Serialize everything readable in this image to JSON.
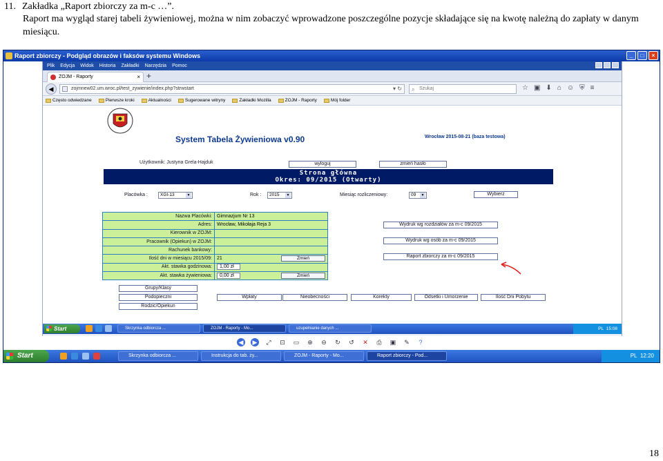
{
  "doc": {
    "number": "11.",
    "heading": "Zakładka „Raport zbiorczy za m-c …”.",
    "paragraph": "Raport ma wygląd starej tabeli żywieniowej, można w nim zobaczyć wprowadzone poszczególne pozycje składające się na kwotę należną do zapłaty w danym miesiącu.",
    "page_number": "18"
  },
  "outer_window": {
    "title": "Raport zbiorczy - Podgląd obrazów i faksów systemu Windows"
  },
  "browser": {
    "menu": [
      "Plik",
      "Edycja",
      "Widok",
      "Historia",
      "Zakładki",
      "Narzędzia",
      "Pomoc"
    ],
    "tab_title": "ZOJM - Raporty",
    "new_tab": "+",
    "url": "zojmnew02.um.wroc.pl/test_zywienie/index.php?strwstart",
    "search_placeholder": "Szukaj",
    "bookmarks": [
      "Często odwiedzane",
      "Pierwsze kroki",
      "Aktualności",
      "Sugerowane witryny",
      "Zakładki Mozilla",
      "ZOJM - Raporty",
      "Mój folder"
    ]
  },
  "app": {
    "title": "System Tabela Żywieniowa v0.90",
    "date_info": "Wrocław 2015-08-21 (baza testowa)",
    "user_label": "Użytkownik: Justyna Grela-Hajduk",
    "logout_button": "wyloguj",
    "change_password_button": "zmień hasło",
    "banner_line1": "Strona główna",
    "banner_line2": "Okres: 09/2015 (Otwarty)",
    "placowka_label": "Placówka :",
    "placowka_value": "XGI-13",
    "rok_label": "Rok :",
    "rok_value": "2015",
    "miesiac_label": "Miesiąc rozliczeniowy:",
    "miesiac_value": "09",
    "wybierz_button": "Wybierz",
    "info": {
      "nazwa_label": "Nazwa Placówki:",
      "nazwa_value": "Gimnazjum Nr 13",
      "adres_label": "Adres:",
      "adres_value": "Wrocław, Mikołaja Reja 3",
      "kierownik_label": "Kierownik w ZOJM:",
      "kierownik_value": "",
      "pracownik_label": "Pracownik (Opiekun) w ZOJM:",
      "pracownik_value": "",
      "rachunek_label": "Rachunek bankowy:",
      "rachunek_value": "",
      "dni_label": "Ilość dni w miesiącu 2015/09:",
      "dni_value": "21",
      "stawka_godz_label": "Akt. stawka godzinowa:",
      "stawka_godz_value": "1,00 zł",
      "stawka_zyw_label": "Akt. stawka żywieniowa:",
      "stawka_zyw_value": "0,00 zł",
      "zmien_button": "Zmień"
    },
    "reports": {
      "wg_rozdzialow": "Wydruk wg rozdziałów za m-c 09/2015",
      "wg_osob": "Wydruk wg osób za m-c 09/2015",
      "zbiorczy": "Raport zbiorczy za m-c 09/2015"
    },
    "side_buttons": [
      "Grupy/Klasy",
      "Podopieczni",
      "Rodzic/Opiekun"
    ],
    "bottom_buttons": [
      "Wpłaty",
      "Nieobecności",
      "Korekty",
      "Odsetki i Umorzenie",
      "Ilość Dni Pobytu"
    ]
  },
  "inner_taskbar": {
    "start": "Start",
    "tasks": [
      "Skrzynka odbiorcza ...",
      "ZOJM - Raporty - Mo...",
      "uzupełnianie danych ..."
    ],
    "clock": "15:08",
    "lang": "PL"
  },
  "outer_taskbar": {
    "start": "Start",
    "tasks": [
      "Skrzynka odbiorcza ...",
      "Instrukcja do tab. ży...",
      "ZOJM - Raporty - Mo...",
      "Raport zbiorczy - Pod..."
    ],
    "clock": "12:20",
    "lang": "PL"
  },
  "colors": {
    "banner": "#001a66",
    "title": "#0e3a90",
    "info_bg": "#ccf09a",
    "info_border": "#2a7ec2",
    "annotation_arrow": "#e02020"
  }
}
